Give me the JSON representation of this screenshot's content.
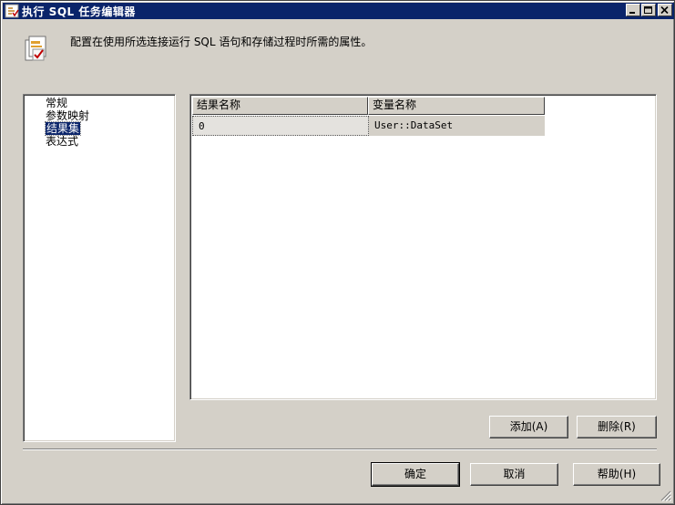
{
  "window": {
    "title": "执行 SQL 任务编辑器",
    "controls": [
      "minimize-icon",
      "maximize-icon",
      "close-icon"
    ]
  },
  "header": {
    "description": "配置在使用所选连接运行 SQL 语句和存储过程时所需的属性。",
    "icon": "task-properties-icon"
  },
  "nav": {
    "items": [
      {
        "label": "常规",
        "selected": false
      },
      {
        "label": "参数映射",
        "selected": false
      },
      {
        "label": "结果集",
        "selected": true
      },
      {
        "label": "表达式",
        "selected": false
      }
    ]
  },
  "grid": {
    "columns": [
      "结果名称",
      "变量名称"
    ],
    "rows": [
      [
        "0",
        "User::DataSet"
      ]
    ]
  },
  "buttons": {
    "add": "添加(A)",
    "delete": "删除(R)",
    "ok": "确定",
    "cancel": "取消",
    "help": "帮助(H)"
  },
  "colors": {
    "titlebar": "#0a246a",
    "face": "#d4d0c8",
    "selection": "#0a246a"
  }
}
